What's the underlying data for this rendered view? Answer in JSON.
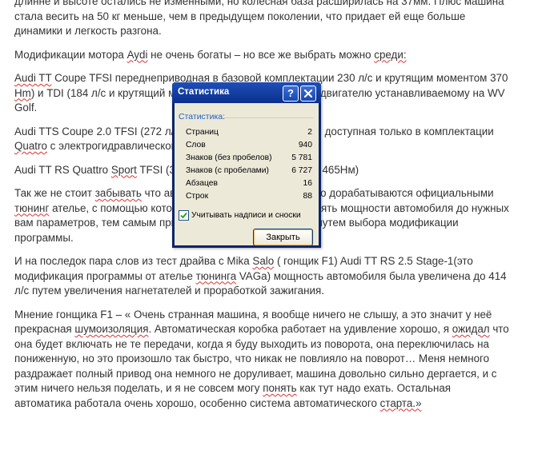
{
  "document": {
    "paragraphs": [
      [
        {
          "t": "длинне и высоте остались не изменными,  но колесная база расширилась на 37мм. Плюс машина стала  весить на 50 кг меньше, чем в предыдущем поколении, что придает ей еще больше динамики и легкость разгона."
        }
      ],
      [
        {
          "t": "Модификации мотора "
        },
        {
          "t": "Aydi",
          "sq": true
        },
        {
          "t": " не очень богаты – но все же выбрать можно "
        },
        {
          "t": "среди:",
          "sq": true
        }
      ],
      [
        {
          "t": " "
        },
        {
          "t": "Audi TT",
          "sq": true
        },
        {
          "t": "  Coupe TFSI переднеприводная   в базовой комплектации 230 л/с и крутящим моментом 370 "
        },
        {
          "t": "Нm",
          "sq": true
        },
        {
          "t": ") и TDI (184 л/с и крутящий момент 380 Нм) едиентичный двигателю устанавливаемому на WV Golf."
        }
      ],
      [
        {
          "t": "Audi TTS Coupe 2.0 TFSI (272 л/с и крутящий момент 380 Нм) доступная только в комплектации "
        },
        {
          "t": "Quatro",
          "sq": true
        },
        {
          "t": " с электрогидравлической многодисковой муфтой"
        }
      ],
      [
        {
          "t": "Audi TT RS Quattro "
        },
        {
          "t": "Sport",
          "sq": true
        },
        {
          "t": "  TFSI (310 л/с и крутящим моментом 465Нм)"
        }
      ],
      [
        {
          "t": "Так же не стоит "
        },
        {
          "t": "забывать",
          "sq": true
        },
        {
          "t": "  что автомобили Audi TT очень часто дорабатываются  официальными "
        },
        {
          "t": "тюнинг",
          "sq": true
        },
        {
          "t": " ателье, с помощью которых можно существенно  поднять мощности автомобиля до нужных вам параметров, тем самым приводим мощность двигателя путем выбора модификации программы."
        }
      ],
      [
        {
          "t": "И на последок пара слов из тест драйва  с Mika "
        },
        {
          "t": "Salo",
          "sq": true
        },
        {
          "t": " ( гонщик F1)  Audi TT RS 2.5 Stage-1(это модификация программы от ателье "
        },
        {
          "t": "тюнинга",
          "sq": true
        },
        {
          "t": " VAGa) мощность автомобиля  была увеличена до 414 л/с путем увеличения нагнетателей и проработкой зажигания."
        }
      ],
      [
        {
          "t": "Мнение гонщика F1 – « Очень странная машина, я вообще ничего не слышу, а это значит у неё прекрасная "
        },
        {
          "t": "шумоизоляция",
          "sq": true
        },
        {
          "t": ". Автоматическая  коробка работает на удивление хорошо, я "
        },
        {
          "t": "ожидал",
          "sq": true
        },
        {
          "t": " что она будет включать  не те передачи, когда я буду выходить из поворота, она переключилась на пониженную, но это произошло так быстро, что никак не повлияло на поворот… Меня немного раздражает  полный привод она немного не доруливает,  машина довольно сильно дергается, и с этим ничего нельзя поделать, и я не совсем могу "
        },
        {
          "t": "понять",
          "sq": true
        },
        {
          "t": " как тут надо ехать.  Остальная  автоматика  работала  очень хорошо, особенно система автоматического "
        },
        {
          "t": "старта.»",
          "sq": true
        }
      ]
    ]
  },
  "dialog": {
    "title": "Статистика",
    "help_glyph": "?",
    "group_label": "Статистика:",
    "stats": [
      {
        "label": "Страниц",
        "value": "2"
      },
      {
        "label": "Слов",
        "value": "940"
      },
      {
        "label": "Знаков (без пробелов)",
        "value": "5 781"
      },
      {
        "label": "Знаков (с пробелами)",
        "value": "6 727"
      },
      {
        "label": "Абзацев",
        "value": "16"
      },
      {
        "label": "Строк",
        "value": "88"
      }
    ],
    "checkbox_label": "Учитывать надписи и сноски",
    "checkbox_checked": true,
    "close_button": "Закрыть"
  }
}
